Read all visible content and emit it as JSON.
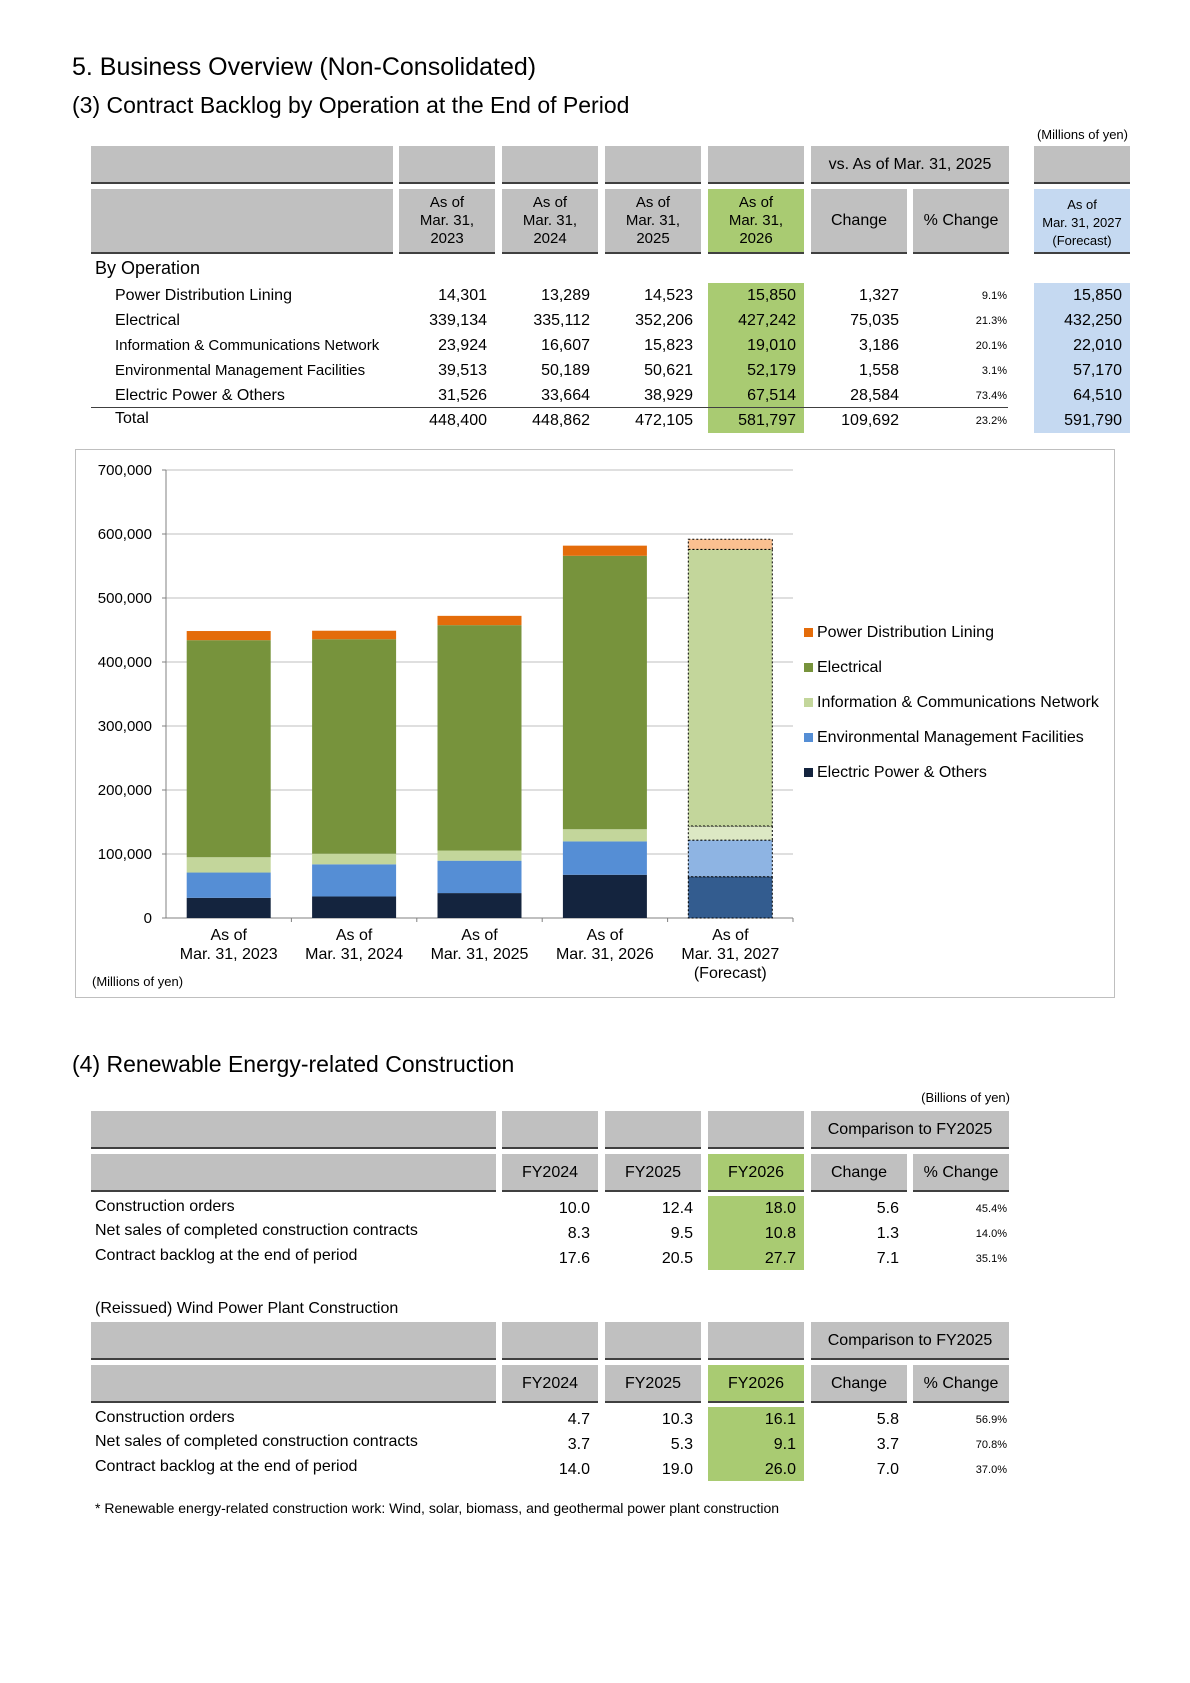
{
  "section_title": "5. Business Overview (Non-Consolidated)",
  "backlog": {
    "title": "(3) Contract Backlog by Operation at the End of Period",
    "unit": "(Millions of yen)",
    "compare_header": "vs. As of Mar. 31, 2025",
    "col_headers": [
      "As of\nMar. 31,\n2023",
      "As of\nMar. 31,\n2024",
      "As of\nMar. 31,\n2025",
      "As of\nMar. 31,\n2026"
    ],
    "change_header": "Change",
    "pct_header": "% Change",
    "forecast_header": "As of\nMar. 31, 2027\n(Forecast)",
    "group_label": "By Operation",
    "rows": [
      {
        "label": "Power Distribution Lining",
        "values": [
          "14,301",
          "13,289",
          "14,523",
          "15,850"
        ],
        "change": "1,327",
        "pct": "9.1%",
        "forecast": "15,850"
      },
      {
        "label": "Electrical",
        "values": [
          "339,134",
          "335,112",
          "352,206",
          "427,242"
        ],
        "change": "75,035",
        "pct": "21.3%",
        "forecast": "432,250"
      },
      {
        "label": "Information & Communications Network",
        "values": [
          "23,924",
          "16,607",
          "15,823",
          "19,010"
        ],
        "change": "3,186",
        "pct": "20.1%",
        "forecast": "22,010"
      },
      {
        "label": "Environmental Management Facilities",
        "values": [
          "39,513",
          "50,189",
          "50,621",
          "52,179"
        ],
        "change": "1,558",
        "pct": "3.1%",
        "forecast": "57,170"
      },
      {
        "label": "Electric Power & Others",
        "values": [
          "31,526",
          "33,664",
          "38,929",
          "67,514"
        ],
        "change": "28,584",
        "pct": "73.4%",
        "forecast": "64,510"
      }
    ],
    "total": {
      "label": "Total",
      "values": [
        "448,400",
        "448,862",
        "472,105",
        "581,797"
      ],
      "change": "109,692",
      "pct": "23.2%",
      "forecast": "591,790"
    }
  },
  "chart_data": {
    "type": "bar",
    "stacked": true,
    "categories": [
      "As of\nMar. 31, 2023",
      "As of\nMar. 31, 2024",
      "As of\nMar. 31, 2025",
      "As of\nMar. 31, 2026",
      "As of\nMar. 31, 2027\n(Forecast)"
    ],
    "ylim": [
      0,
      700000
    ],
    "yticks": [
      "0",
      "100,000",
      "200,000",
      "300,000",
      "400,000",
      "500,000",
      "600,000",
      "700,000"
    ],
    "grid": true,
    "legend_position": "right",
    "unit_note": "(Millions of yen)",
    "series": [
      {
        "name": "Electric Power & Others",
        "color": "#14243e",
        "forecast_color": "#335c8f",
        "values": [
          31526,
          33664,
          38929,
          67514,
          64510
        ]
      },
      {
        "name": "Environmental Management Facilities",
        "color": "#558ed5",
        "forecast_color": "#8eb4e3",
        "values": [
          39513,
          50189,
          50621,
          52179,
          57170
        ]
      },
      {
        "name": "Information & Communications Network",
        "color": "#c3d69b",
        "forecast_color": "#dce8c4",
        "values": [
          23924,
          16607,
          15823,
          19010,
          22010
        ]
      },
      {
        "name": "Electrical",
        "color": "#77933c",
        "forecast_color": "#c3d69b",
        "values": [
          339134,
          335112,
          352206,
          427242,
          432250
        ]
      },
      {
        "name": "Power Distribution Lining",
        "color": "#e46c0a",
        "forecast_color": "#fac090",
        "values": [
          14301,
          13289,
          14523,
          15850,
          15850
        ]
      }
    ],
    "legend_order": [
      "Power Distribution Lining",
      "Electrical",
      "Information & Communications Network",
      "Environmental Management Facilities",
      "Electric Power & Others"
    ]
  },
  "renewable": {
    "title": "(4) Renewable Energy-related Construction",
    "unit": "(Billions of yen)",
    "compare_header": "Comparison to FY2025",
    "col_headers": [
      "FY2024",
      "FY2025",
      "FY2026"
    ],
    "change_header": "Change",
    "pct_header": "% Change",
    "rows": [
      {
        "label": "Construction orders",
        "values": [
          "10.0",
          "12.4",
          "18.0"
        ],
        "change": "5.6",
        "pct": "45.4%"
      },
      {
        "label": "Net sales of completed construction contracts",
        "values": [
          "8.3",
          "9.5",
          "10.8"
        ],
        "change": "1.3",
        "pct": "14.0%"
      },
      {
        "label": "Contract backlog at the end of period",
        "values": [
          "17.6",
          "20.5",
          "27.7"
        ],
        "change": "7.1",
        "pct": "35.1%"
      }
    ]
  },
  "wind": {
    "title": "(Reissued) Wind Power Plant Construction",
    "compare_header": "Comparison to FY2025",
    "col_headers": [
      "FY2024",
      "FY2025",
      "FY2026"
    ],
    "change_header": "Change",
    "pct_header": "% Change",
    "rows": [
      {
        "label": "Construction orders",
        "values": [
          "4.7",
          "10.3",
          "16.1"
        ],
        "change": "5.8",
        "pct": "56.9%"
      },
      {
        "label": "Net sales of completed construction contracts",
        "values": [
          "3.7",
          "5.3",
          "9.1"
        ],
        "change": "3.7",
        "pct": "70.8%"
      },
      {
        "label": "Contract backlog at the end of period",
        "values": [
          "14.0",
          "19.0",
          "26.0"
        ],
        "change": "7.0",
        "pct": "37.0%"
      }
    ]
  },
  "footnote": "* Renewable energy-related construction work: Wind, solar, biomass, and geothermal power plant construction"
}
